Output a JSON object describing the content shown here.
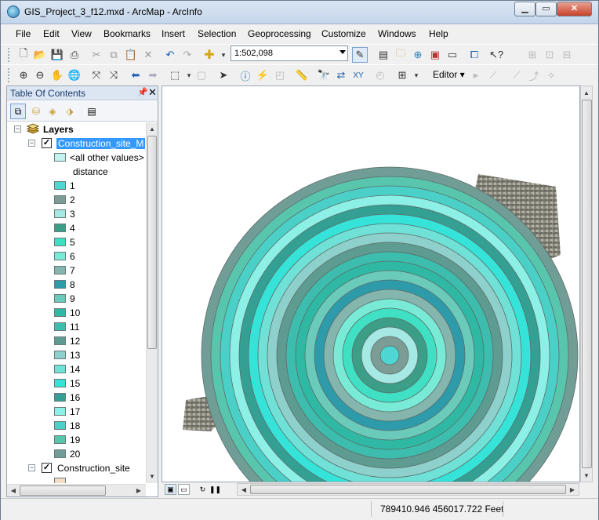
{
  "window": {
    "title": "GIS_Project_3_f12.mxd - ArcMap - ArcInfo"
  },
  "menu": [
    "File",
    "Edit",
    "View",
    "Bookmarks",
    "Insert",
    "Selection",
    "Geoprocessing",
    "Customize",
    "Windows",
    "Help"
  ],
  "toolbar": {
    "scale": "1:502,098",
    "editor_label": "Editor ▾"
  },
  "toc": {
    "title": "Table Of Contents",
    "root_label": "Layers",
    "layer1_name": "Construction_site_M",
    "other_values_label": "<all other values>",
    "field_label": "distance",
    "classes": [
      {
        "label": "1",
        "color": "#4fd6d3"
      },
      {
        "label": "2",
        "color": "#7c9d95"
      },
      {
        "label": "3",
        "color": "#a6e8e4"
      },
      {
        "label": "4",
        "color": "#3c9e86"
      },
      {
        "label": "5",
        "color": "#3fe0c3"
      },
      {
        "label": "6",
        "color": "#78ead6"
      },
      {
        "label": "7",
        "color": "#84b6ad"
      },
      {
        "label": "8",
        "color": "#2d9ba9"
      },
      {
        "label": "9",
        "color": "#6bcbbb"
      },
      {
        "label": "10",
        "color": "#2fb8a3"
      },
      {
        "label": "11",
        "color": "#3dbdad"
      },
      {
        "label": "12",
        "color": "#5e9b91"
      },
      {
        "label": "13",
        "color": "#8ed0cb"
      },
      {
        "label": "14",
        "color": "#6fe1d6"
      },
      {
        "label": "15",
        "color": "#35e3d9"
      },
      {
        "label": "16",
        "color": "#34a093"
      },
      {
        "label": "17",
        "color": "#8df0e6"
      },
      {
        "label": "18",
        "color": "#4bd0c8"
      },
      {
        "label": "19",
        "color": "#58c6ad"
      },
      {
        "label": "20",
        "color": "#709e97"
      }
    ],
    "other_values_color": "#c3f4f2",
    "layer2_name": "Construction_site"
  },
  "status": {
    "coordinates": "789410.946  456017.722 Feet"
  }
}
